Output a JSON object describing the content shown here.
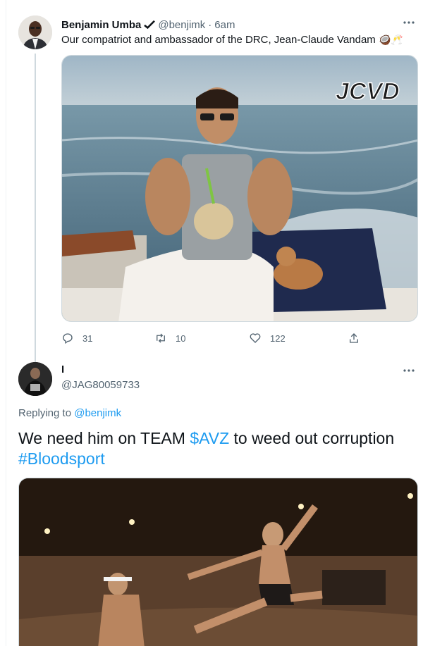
{
  "parent_tweet": {
    "author_name": "Benjamin Umba",
    "handle": "@benjimk",
    "separator": "·",
    "time": "6am",
    "text": "Our compatriot and ambassador of the DRC, Jean-Claude Vandam",
    "text_emoji": "🥥🥂",
    "photo_watermark": "JCVD",
    "stats": {
      "replies": "31",
      "retweets": "10",
      "likes": "122"
    }
  },
  "reply_tweet": {
    "author_name": "I",
    "handle": "@JAG80059733",
    "replying_prefix": "Replying to",
    "replying_to": "@benjimk",
    "text_part1": "We need him on TEAM ",
    "cashtag": "$AVZ",
    "text_part2": " to weed out corruption",
    "hashtag": "#Bloodsport"
  },
  "icons": {
    "verified": "verified-badge-icon",
    "more": "more-dots-icon",
    "reply": "reply-bubble-icon",
    "retweet": "retweet-icon",
    "like": "heart-icon",
    "share": "share-icon"
  },
  "colors": {
    "link": "#1d9bf0",
    "secondary_text": "#536471",
    "primary_text": "#0f1419",
    "border": "#cfd9de"
  }
}
